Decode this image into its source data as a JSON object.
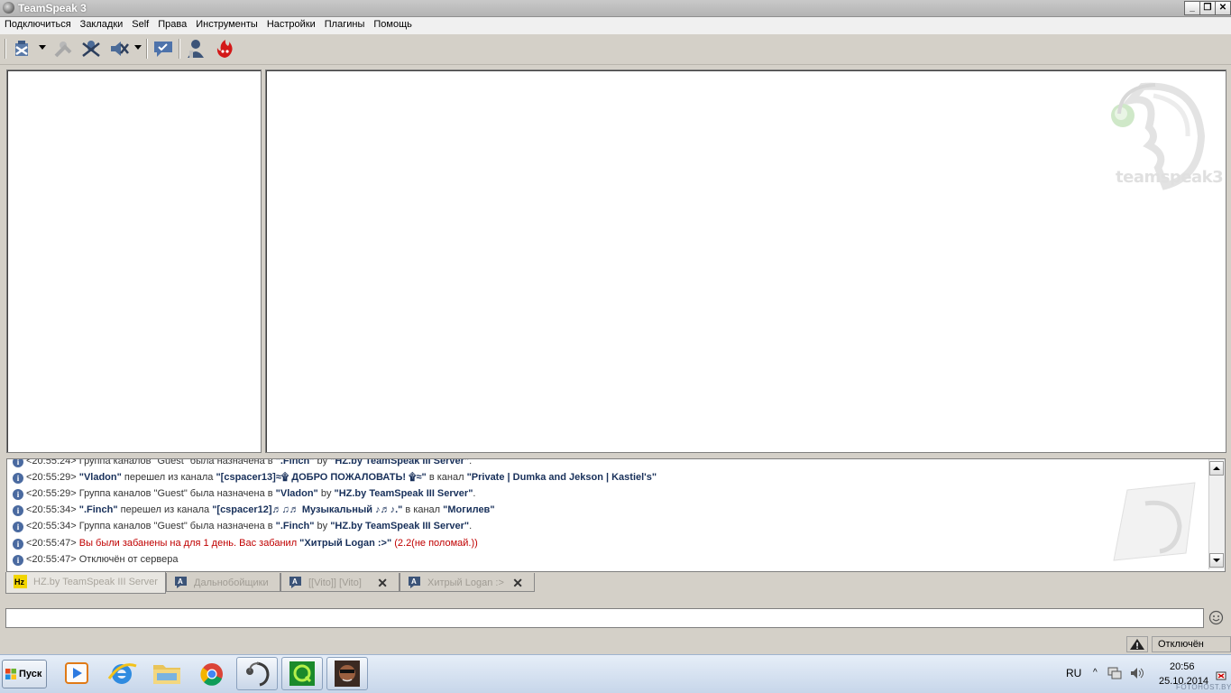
{
  "window": {
    "title": "TeamSpeak 3"
  },
  "menu": [
    "Подключиться",
    "Закладки",
    "Self",
    "Права",
    "Инструменты",
    "Настройки",
    "Плагины",
    "Помощь"
  ],
  "toolbar": {
    "icons": [
      "disconnect-icon",
      "connect-user-icon",
      "mute-microphone-icon",
      "mute-speakers-icon",
      "away-status-icon",
      "contacts-icon",
      "ts3-flame-icon"
    ]
  },
  "watermark": {
    "text": "teamspeak3"
  },
  "log": [
    {
      "time": "<20:55:24>",
      "pre": " Группа каналов \"Guest\" была назначена в ",
      "b1": "\".Finch\"",
      "mid": " by ",
      "b2": "\"HZ.by TeamSpeak III Server\"",
      "post": "."
    },
    {
      "time": "<20:55:29>",
      "b1": "\"Vladon\"",
      "mid": " перешел из канала ",
      "b2": "\"[cspacer13]≈۩ ДОБРО ПОЖАЛОВАТЬ! ۩≈\"",
      "mid2": " в канал ",
      "b3": "\"Private | Dumka and Jekson | Kastiel's\""
    },
    {
      "time": "<20:55:29>",
      "pre": " Группа каналов \"Guest\" была назначена в ",
      "b1": "\"Vladon\"",
      "mid": " by ",
      "b2": "\"HZ.by TeamSpeak III Server\"",
      "post": "."
    },
    {
      "time": "<20:55:34>",
      "b1": "\".Finch\"",
      "mid": " перешел из канала ",
      "b2": "\"[cspacer12]♬♫♬ Музыкальный ♪♬♪.\"",
      "mid2": " в канал ",
      "b3": "\"Могилев\""
    },
    {
      "time": "<20:55:34>",
      "pre": " Группа каналов \"Guest\" была назначена в ",
      "b1": "\".Finch\"",
      "mid": " by ",
      "b2": "\"HZ.by TeamSpeak III Server\"",
      "post": "."
    },
    {
      "time": "<20:55:47>",
      "red": " Вы были забанены на для 1 день. Вас забанил ",
      "b1": "\"Хитрый Logan :>\"",
      "red2": " (2.2(не поломай.))"
    },
    {
      "time": "<20:55:47>",
      "pre": " Отключён от сервера"
    }
  ],
  "tabs": [
    {
      "label": "HZ.by TeamSpeak III Server",
      "icon": "hz-server-icon",
      "active": true,
      "closable": false
    },
    {
      "label": "Дальнобойщики",
      "icon": "channel-chat-icon",
      "active": false,
      "closable": false
    },
    {
      "label": "[[Vito]] [Vito]",
      "icon": "channel-chat-icon",
      "active": false,
      "closable": true
    },
    {
      "label": "Хитрый Logan :>",
      "icon": "channel-chat-icon",
      "active": false,
      "closable": true
    }
  ],
  "tab_close_glyph": "✕",
  "chat": {
    "value": ""
  },
  "status": {
    "text": "Отключён"
  },
  "taskbar": {
    "start_label": "Пуск",
    "apps": [
      "media-player-icon",
      "internet-explorer-icon",
      "file-explorer-icon",
      "chrome-icon",
      "teamspeak-icon",
      "game-launcher-icon",
      "gta-sa-icon"
    ],
    "lang": "RU",
    "time": "20:56",
    "date": "25.10.2014",
    "watermark": "FOTOHOST.BY"
  }
}
